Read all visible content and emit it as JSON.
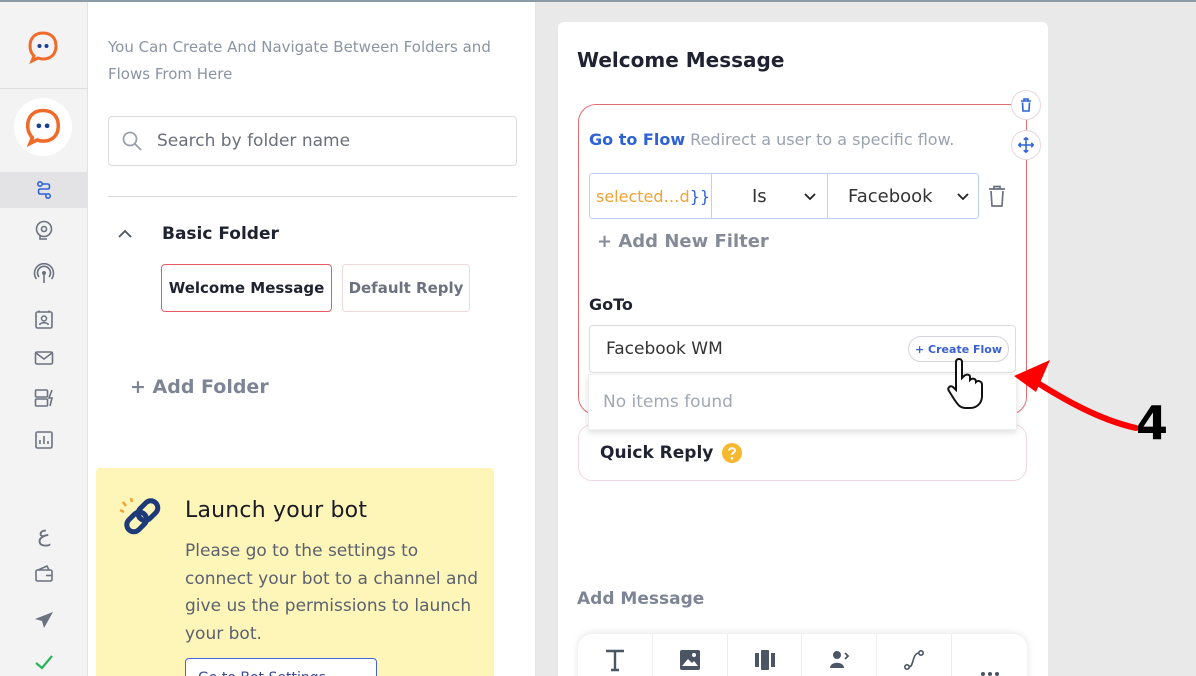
{
  "sidebar": {
    "items": [
      {
        "name": "flows",
        "icon": "flow-icon",
        "active": true
      },
      {
        "name": "ai",
        "icon": "brain-gear-icon"
      },
      {
        "name": "broadcast",
        "icon": "broadcast-icon"
      },
      {
        "name": "contacts",
        "icon": "contact-card-icon"
      },
      {
        "name": "messages",
        "icon": "mail-icon"
      },
      {
        "name": "integrations",
        "icon": "server-bolt-icon"
      },
      {
        "name": "analytics",
        "icon": "chart-icon"
      }
    ],
    "bottom": [
      {
        "name": "language",
        "label": "ع"
      },
      {
        "name": "wallet",
        "icon": "wallet-icon"
      },
      {
        "name": "send",
        "icon": "send-icon"
      },
      {
        "name": "status",
        "icon": "check-icon"
      }
    ]
  },
  "folders_panel": {
    "hint": "You Can Create And Navigate Between Folders and Flows From Here",
    "search_placeholder": "Search by folder name",
    "folder_name": "Basic Folder",
    "flows": [
      "Welcome Message",
      "Default Reply"
    ],
    "add_folder_label": "+ Add Folder"
  },
  "launch": {
    "title": "Launch your bot",
    "text": "Please go to the settings to connect your bot to a channel and give us the permissions to launch your bot.",
    "button_label": "Go to Bot Settings"
  },
  "editor": {
    "title": "Welcome Message",
    "goto_strong": "Go to Flow",
    "goto_desc": " Redirect a user to a specific flow.",
    "filter": {
      "var_orange": "selected…d",
      "var_brace": "}}",
      "operator": "Is",
      "value": "Facebook"
    },
    "add_filter_label": "+ Add New Filter",
    "goto_label": "GoTo",
    "goto_value": "Facebook WM",
    "create_flow_label": "+ Create Flow",
    "no_items": "No items found",
    "quick_reply_label": "Quick Reply",
    "add_message_label": "Add Message"
  },
  "annotation": {
    "step": "4",
    "color": "#ff0000"
  },
  "colors": {
    "brand_orange": "#f06b2a",
    "accent_blue": "#2e62d6",
    "launch_bg": "#fdf6b8"
  }
}
